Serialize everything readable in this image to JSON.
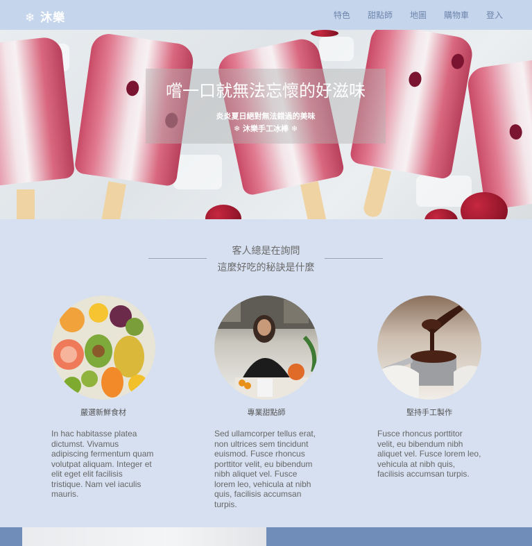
{
  "nav": {
    "brand": "❄ 沐樂",
    "links": [
      "特色",
      "甜點師",
      "地圖",
      "購物車",
      "登入"
    ]
  },
  "hero": {
    "title": "嚐一口就無法忘懷的好滋味",
    "subtitle": "炎炎夏日絕對無法錯過的美味",
    "tagline": "❄ 沐樂手工冰棒 ❄"
  },
  "section": {
    "question_line1": "客人總是在詢問",
    "question_line2": "這麼好吃的秘訣是什麼"
  },
  "features": [
    {
      "title": "嚴選新鮮食材",
      "text": "In hac habitasse platea dictumst. Vivamus adipiscing fermentum quam volutpat aliquam. Integer et elit eget elit facilisis tristique. Nam vel iaculis mauris."
    },
    {
      "title": "專業甜點師",
      "text": "Sed ullamcorper tellus erat, non ultrices sem tincidunt euismod. Fusce rhoncus porttitor velit, eu bibendum nibh aliquet vel. Fusce lorem leo, vehicula at nibh quis, facilisis accumsan turpis."
    },
    {
      "title": "堅持手工製作",
      "text": "Fusce rhoncus porttitor velit, eu bibendum nibh aliquet vel. Fusce lorem leo, vehicula at nibh quis, facilisis accumsan turpis."
    }
  ],
  "colors": {
    "nav_bg": "#c5d5ec",
    "page_bg": "#d6e0f0",
    "nav_link": "#6e86ad",
    "footer_blue": "#6f8db8"
  }
}
